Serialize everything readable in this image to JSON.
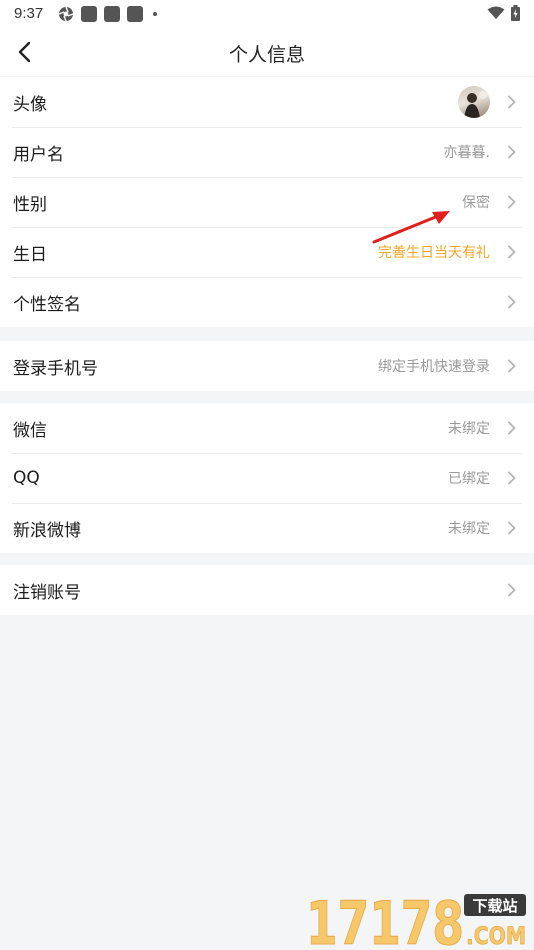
{
  "statusbar": {
    "time": "9:37"
  },
  "header": {
    "title": "个人信息"
  },
  "profile": {
    "avatar_label": "头像",
    "username_label": "用户名",
    "username_value": "亦暮暮.",
    "gender_label": "性别",
    "gender_value": "保密",
    "birthday_label": "生日",
    "birthday_value": "完善生日当天有礼",
    "signature_label": "个性签名"
  },
  "phone": {
    "label": "登录手机号",
    "value": "绑定手机快速登录"
  },
  "social": {
    "wechat_label": "微信",
    "wechat_value": "未绑定",
    "qq_label": "QQ",
    "qq_value": "已绑定",
    "weibo_label": "新浪微博",
    "weibo_value": "未绑定"
  },
  "account": {
    "cancel_label": "注销账号"
  },
  "watermark": {
    "number": "17178",
    "tag": "下载站",
    "domain": ".COM"
  },
  "colors": {
    "accent_orange": "#f5a623",
    "secondary_text": "#9a9a9a",
    "annotation_red": "#e0201b"
  }
}
